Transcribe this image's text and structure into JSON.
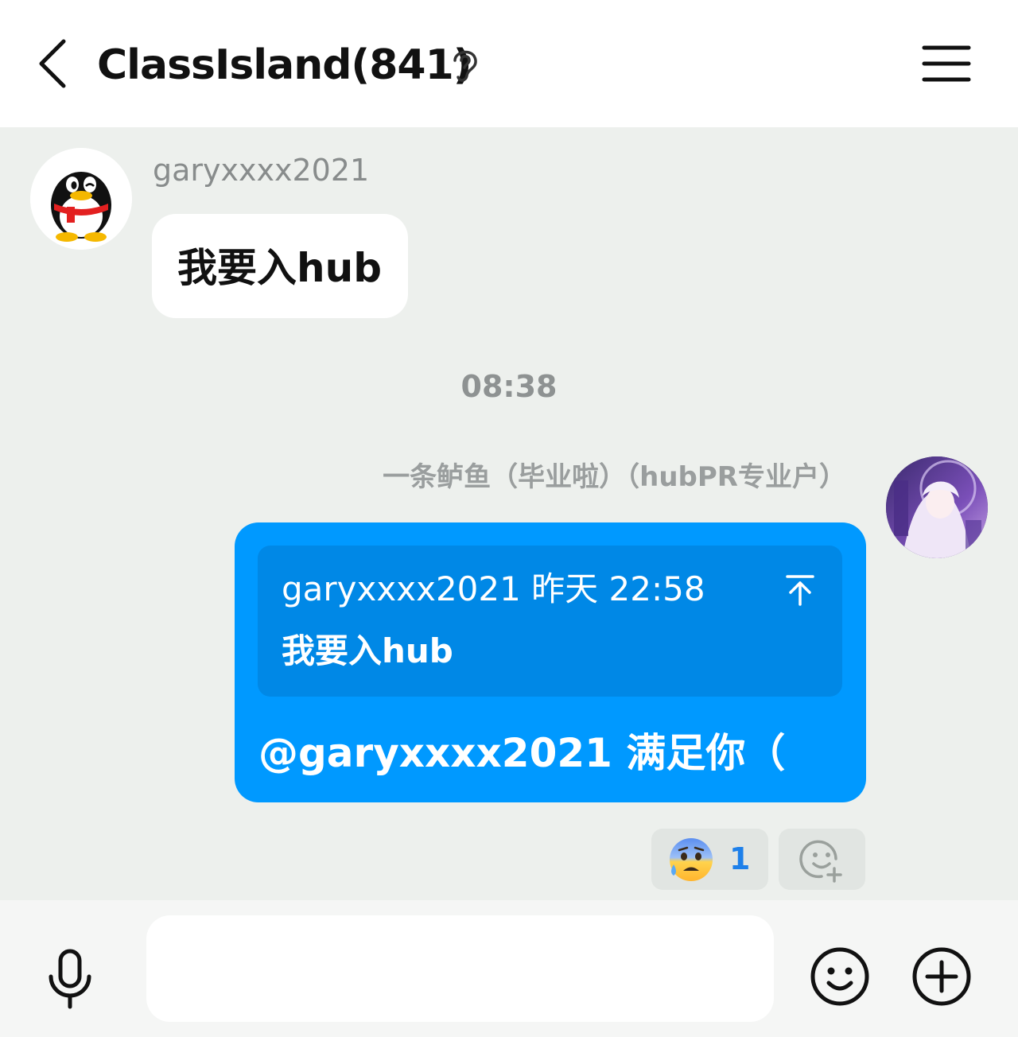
{
  "header": {
    "title": "ClassIsland(841)",
    "back_icon": "chevron-left-icon",
    "ear_icon": "ear-icon",
    "menu_icon": "hamburger-menu-icon"
  },
  "messages": [
    {
      "sender": "garyxxxx2021",
      "avatar": "qq-penguin-avatar",
      "text": "我要入hub"
    }
  ],
  "timestamp": "08:38",
  "reply_message": {
    "sender": "一条鲈鱼（毕业啦）（hubPR专业户）",
    "avatar": "anime-avatar",
    "quote_header": "garyxxxx2021 昨天 22:58",
    "quote_text": "我要入hub",
    "text": "@garyxxxx2021 满足你（",
    "bubble_color": "#0099ff"
  },
  "reactions": [
    {
      "emoji": "anxious-face-with-sweat-emoji",
      "count": "1",
      "count_color": "#1e80ea"
    }
  ],
  "input_bar": {
    "placeholder": "",
    "mic_icon": "microphone-icon",
    "emoji_icon": "smiley-icon",
    "plus_icon": "plus-circle-icon"
  },
  "colors": {
    "chat_background": "#edf0ed",
    "header_background": "#ffffff",
    "accent_blue": "#0099ff"
  }
}
